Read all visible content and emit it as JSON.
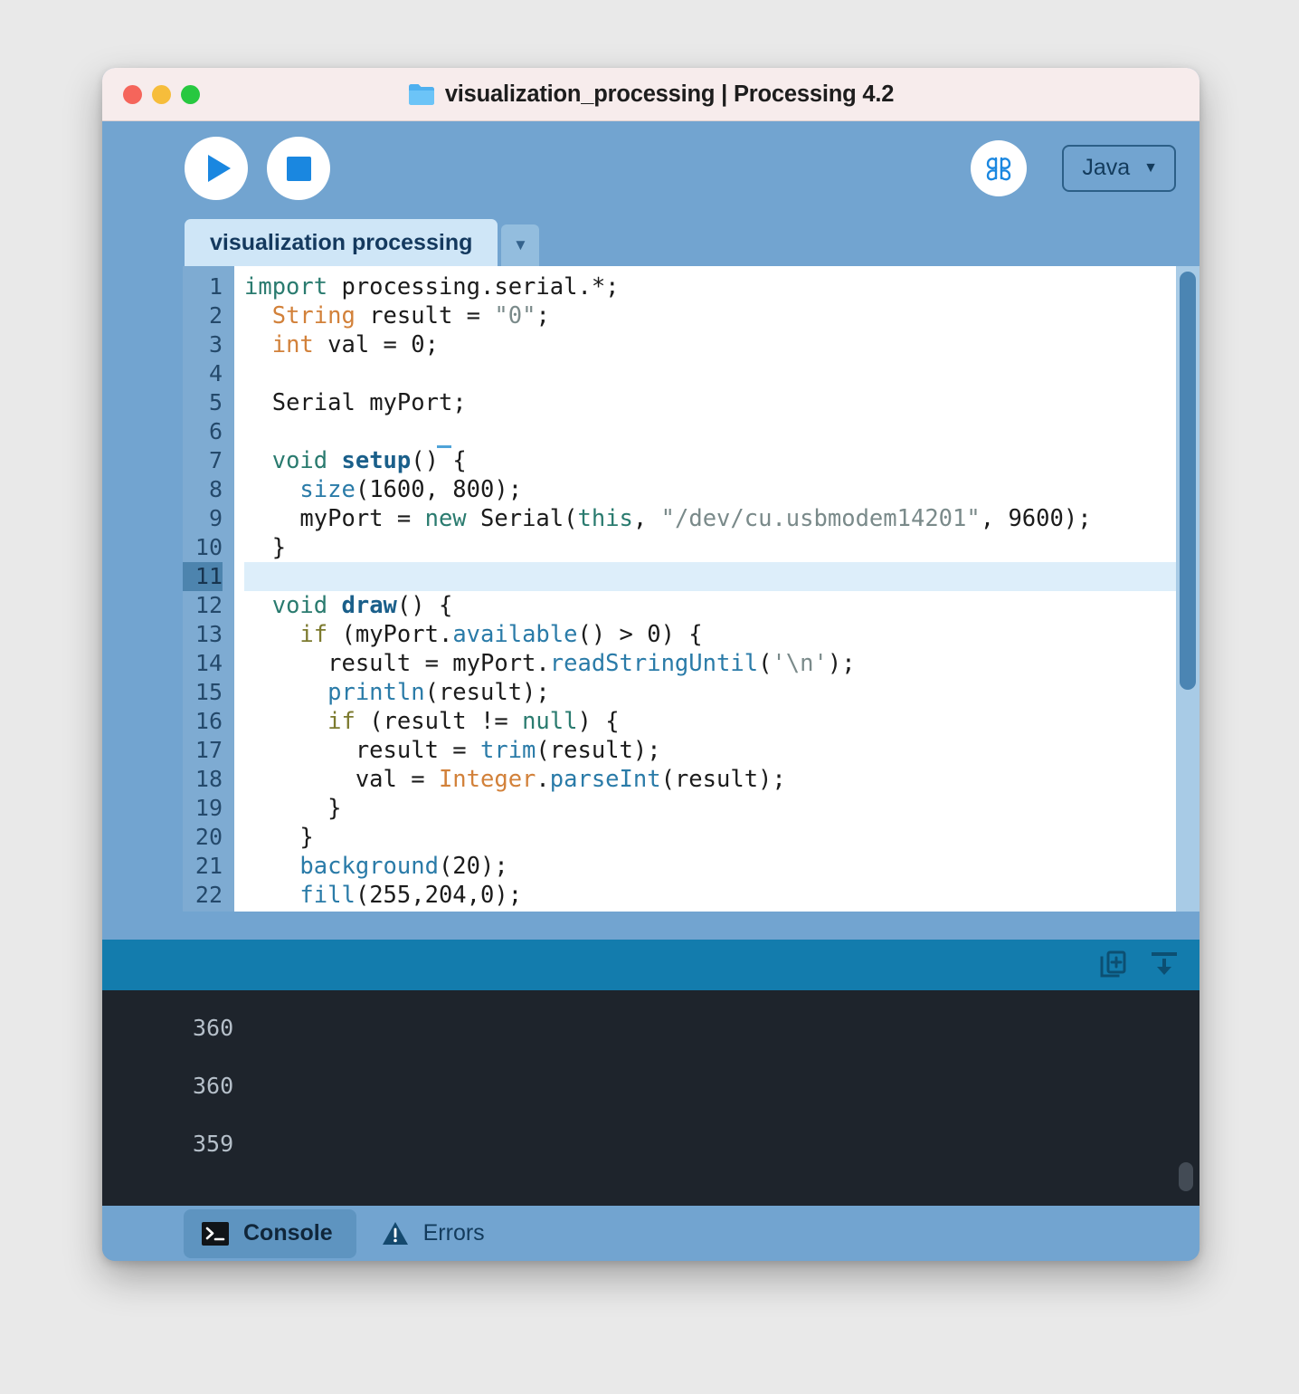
{
  "window": {
    "title": "visualization_processing | Processing 4.2",
    "folder_icon": "folder-icon",
    "traffic_lights": [
      "close",
      "minimize",
      "maximize"
    ],
    "colors": {
      "chrome": "#72a4d0",
      "titlebar": "#f7ecec",
      "console_header": "#137cad",
      "console_body": "#1e242c",
      "accent_blue": "#1a87e0",
      "red": "#f5655b",
      "yellow": "#f6bd3b",
      "green": "#28c840"
    }
  },
  "toolbar": {
    "run_label": "run-button",
    "stop_label": "stop-button",
    "debug_label": "debug-button",
    "mode_label": "Java",
    "mode_caret": "▼"
  },
  "tabs": {
    "sketch_name": "visualization processing",
    "menu_caret": "▼"
  },
  "editor": {
    "line_numbers": [
      "1",
      "2",
      "3",
      "4",
      "5",
      "6",
      "7",
      "8",
      "9",
      "10",
      "11",
      "12",
      "13",
      "14",
      "15",
      "16",
      "17",
      "18",
      "19",
      "20",
      "21",
      "22"
    ],
    "active_line": 11,
    "lines": [
      "import processing.serial.*;",
      "  String result = \"0\";",
      "  int val = 0;",
      "",
      "  Serial myPort;",
      "",
      "  void setup() {",
      "    size(1600, 800);",
      "    myPort = new Serial(this, \"/dev/cu.usbmodem14201\", 9600);",
      "  }",
      "",
      "  void draw() {",
      "    if (myPort.available() > 0) {",
      "      result = myPort.readStringUntil('\\n');",
      "      println(result);",
      "      if (result != null) {",
      "        result = trim(result);",
      "        val = Integer.parseInt(result);",
      "      }",
      "    }",
      "    background(20);",
      "    fill(255,204,0);"
    ]
  },
  "console": {
    "copy_icon": "copy-icon",
    "scroll_bottom_icon": "scroll-to-bottom-icon",
    "output": [
      "360",
      "360",
      "359"
    ]
  },
  "status_tabs": [
    {
      "label": "Console",
      "icon": "terminal-icon",
      "active": true
    },
    {
      "label": "Errors",
      "icon": "warning-icon",
      "active": false
    }
  ]
}
